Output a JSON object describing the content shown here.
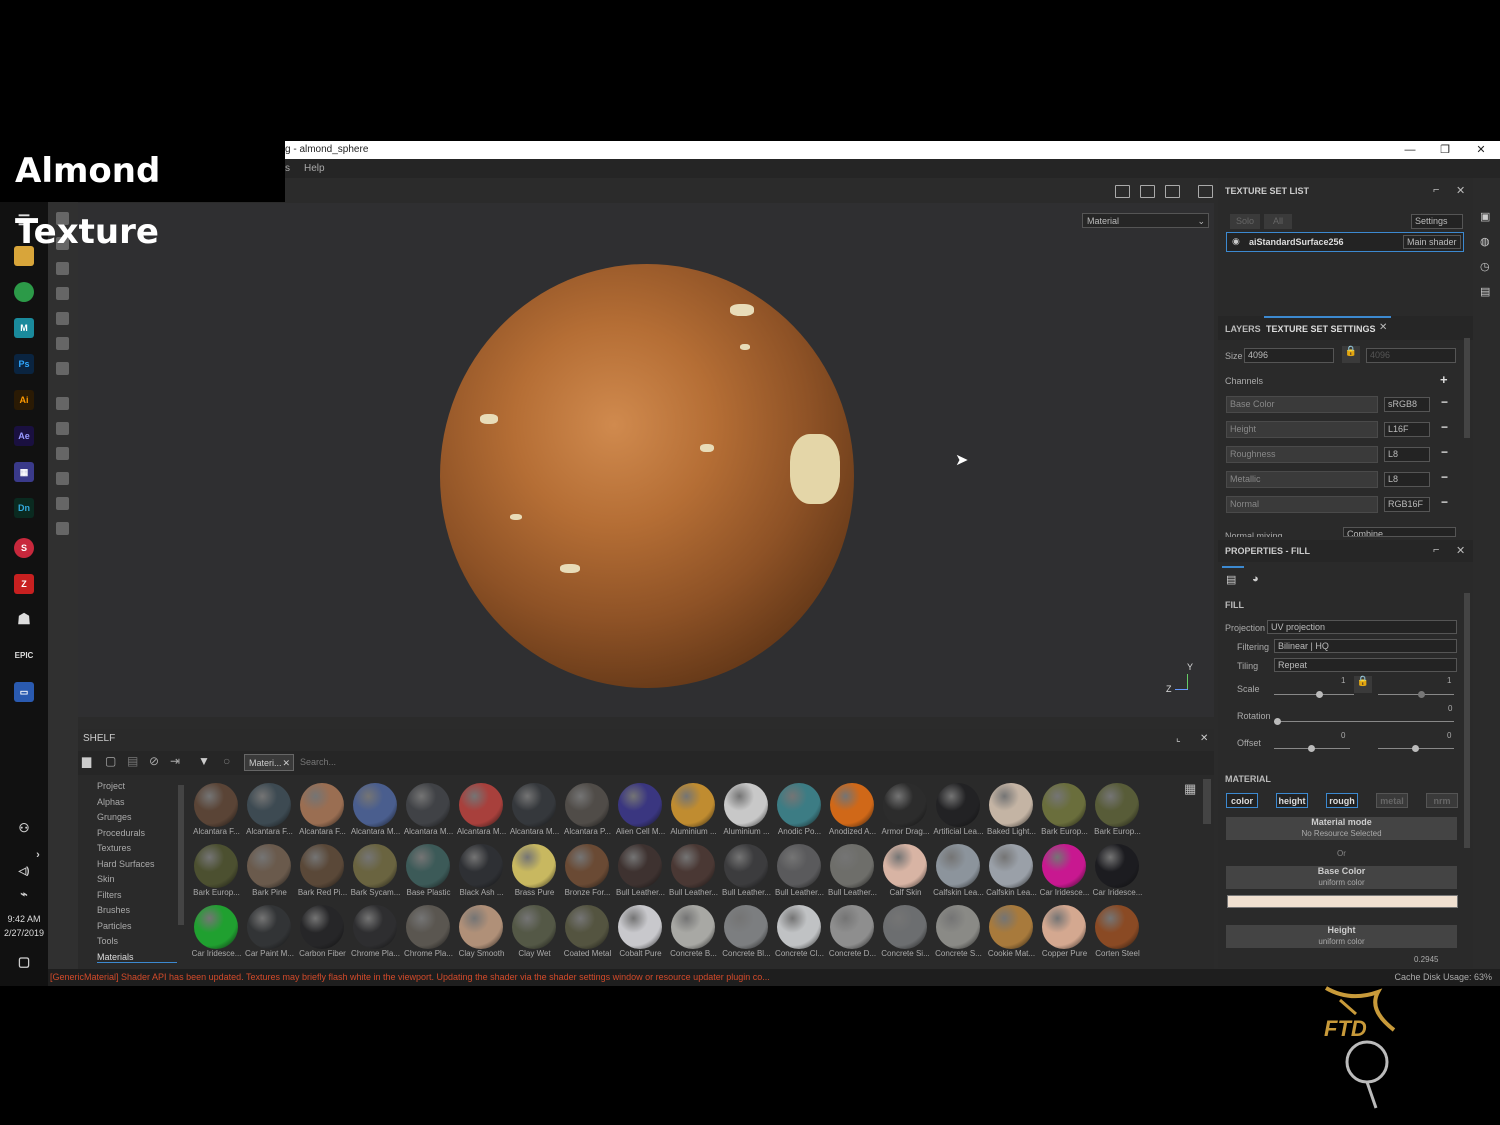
{
  "overlay_title": "Almond Texture",
  "window": {
    "title": "g - almond_sphere",
    "menu": [
      {
        "label": "s"
      },
      {
        "label": "Help"
      }
    ],
    "controls": [
      "—",
      "❐",
      "✕"
    ]
  },
  "viewport": {
    "mode_select": "Material",
    "axis_y": "Y",
    "axis_z": "Z"
  },
  "taskbar": {
    "time": "9:42 AM",
    "date": "2/27/2019"
  },
  "shelf": {
    "title": "SHELF",
    "filter_tab": "Materi...",
    "search_placeholder": "Search...",
    "categories": [
      {
        "label": "Project"
      },
      {
        "label": "Alphas"
      },
      {
        "label": "Grunges"
      },
      {
        "label": "Procedurals"
      },
      {
        "label": "Textures"
      },
      {
        "label": "Hard Surfaces"
      },
      {
        "label": "Skin"
      },
      {
        "label": "Filters"
      },
      {
        "label": "Brushes"
      },
      {
        "label": "Particles"
      },
      {
        "label": "Tools"
      },
      {
        "label": "Materials"
      }
    ],
    "materials": [
      {
        "label": "Alcantara F...",
        "color": "#5a4436"
      },
      {
        "label": "Alcantara F...",
        "color": "#3d4a52"
      },
      {
        "label": "Alcantara F...",
        "color": "#9a6e52"
      },
      {
        "label": "Alcantara M...",
        "color": "#4a5e8e"
      },
      {
        "label": "Alcantara M...",
        "color": "#404246"
      },
      {
        "label": "Alcantara M...",
        "color": "#a8403c"
      },
      {
        "label": "Alcantara M...",
        "color": "#35383c"
      },
      {
        "label": "Alcantara P...",
        "color": "#504c48"
      },
      {
        "label": "Alien Cell M...",
        "color": "#3a3680"
      },
      {
        "label": "Aluminium ...",
        "color": "#c08c30"
      },
      {
        "label": "Aluminium ...",
        "color": "#c8c8c8"
      },
      {
        "label": "Anodic Po...",
        "color": "#3c7c84"
      },
      {
        "label": "Anodized A...",
        "color": "#d06818"
      },
      {
        "label": "Armor Drag...",
        "color": "#2c2c2c"
      },
      {
        "label": "Artificial Lea...",
        "color": "#222224"
      },
      {
        "label": "Baked Light...",
        "color": "#c4b4a4"
      },
      {
        "label": "Bark Europ...",
        "color": "#6a6e3c"
      },
      {
        "label": "Bark Europ...",
        "color": "#585c38"
      },
      {
        "label": "Bark Europ...",
        "color": "#4c5030"
      },
      {
        "label": "Bark Pine",
        "color": "#6a5a4c"
      },
      {
        "label": "Bark Red Pi...",
        "color": "#5a4838"
      },
      {
        "label": "Bark Sycam...",
        "color": "#6a6440"
      },
      {
        "label": "Base Plastic",
        "color": "#3c5a58"
      },
      {
        "label": "Black Ash ...",
        "color": "#2e3034"
      },
      {
        "label": "Brass Pure",
        "color": "#c8b860"
      },
      {
        "label": "Bronze For...",
        "color": "#6a4a34"
      },
      {
        "label": "Bull Leather...",
        "color": "#3e3230"
      },
      {
        "label": "Bull Leather...",
        "color": "#4a3834"
      },
      {
        "label": "Bull Leather...",
        "color": "#3c3c3e"
      },
      {
        "label": "Bull Leather...",
        "color": "#5a5a5c"
      },
      {
        "label": "Bull Leather...",
        "color": "#6e6e6a"
      },
      {
        "label": "Calf Skin",
        "color": "#d8b4a4"
      },
      {
        "label": "Calfskin Lea...",
        "color": "#8c949c"
      },
      {
        "label": "Calfskin Lea...",
        "color": "#9aa0a8"
      },
      {
        "label": "Car Iridesce...",
        "color": "#c81890"
      },
      {
        "label": "Car Iridesce...",
        "color": "#1c1c20"
      },
      {
        "label": "Car Iridesce...",
        "color": "#20a030"
      },
      {
        "label": "Car Paint M...",
        "color": "#323436"
      },
      {
        "label": "Carbon Fiber",
        "color": "#262628"
      },
      {
        "label": "Chrome Pla...",
        "color": "#2e2e30"
      },
      {
        "label": "Chrome Pla...",
        "color": "#5a5650"
      },
      {
        "label": "Clay Smooth",
        "color": "#b09078"
      },
      {
        "label": "Clay Wet",
        "color": "#545846"
      },
      {
        "label": "Coated Metal",
        "color": "#545440"
      },
      {
        "label": "Cobalt Pure",
        "color": "#c8c8cc"
      },
      {
        "label": "Concrete B...",
        "color": "#a8a8a4"
      },
      {
        "label": "Concrete Bl...",
        "color": "#7c7e80"
      },
      {
        "label": "Concrete Cl...",
        "color": "#c0c2c4"
      },
      {
        "label": "Concrete D...",
        "color": "#8e8e8e"
      },
      {
        "label": "Concrete Si...",
        "color": "#6c6e70"
      },
      {
        "label": "Concrete S...",
        "color": "#8a8a86"
      },
      {
        "label": "Cookie Mat...",
        "color": "#a87a3c"
      },
      {
        "label": "Copper Pure",
        "color": "#d4a890"
      },
      {
        "label": "Corten Steel",
        "color": "#8a4a24"
      }
    ]
  },
  "status": {
    "message": "[GenericMaterial] Shader API has been updated. Textures may briefly flash white in the viewport. Updating the shader via the shader settings window or resource updater plugin co...",
    "cache": "Cache Disk Usage:   63%"
  },
  "texture_set_list": {
    "title": "TEXTURE SET LIST",
    "solo": "Solo",
    "all": "All",
    "settings": "Settings",
    "set_name": "aiStandardSurface256",
    "shader": "Main shader"
  },
  "texture_set_settings": {
    "tab_layers": "LAYERS",
    "tab_settings": "TEXTURE SET SETTINGS",
    "size_label": "Size",
    "size_value": "4096",
    "size_linked": "4096",
    "channels_label": "Channels",
    "channels": [
      {
        "name": "Base Color",
        "format": "sRGB8"
      },
      {
        "name": "Height",
        "format": "L16F"
      },
      {
        "name": "Roughness",
        "format": "L8"
      },
      {
        "name": "Metallic",
        "format": "L8"
      },
      {
        "name": "Normal",
        "format": "RGB16F"
      }
    ],
    "normal_mixing_label": "Normal mixing",
    "normal_mixing_value": "Combine"
  },
  "properties": {
    "title": "PROPERTIES - FILL",
    "fill_label": "FILL",
    "projection_label": "Projection",
    "projection_value": "UV projection",
    "filtering_label": "Filtering",
    "filtering_value": "Bilinear | HQ",
    "tiling_label": "Tiling",
    "tiling_value": "Repeat",
    "scale_label": "Scale",
    "scale_u": "1",
    "scale_v": "1",
    "rotation_label": "Rotation",
    "rotation_value": "0",
    "offset_label": "Offset",
    "offset_u": "0",
    "offset_v": "0",
    "material_label": "MATERIAL",
    "channel_buttons": [
      {
        "label": "color"
      },
      {
        "label": "height"
      },
      {
        "label": "rough"
      },
      {
        "label": "metal"
      },
      {
        "label": "nrm"
      }
    ],
    "material_mode_title": "Material mode",
    "material_mode_sub": "No Resource Selected",
    "or_label": "Or",
    "base_color_title": "Base Color",
    "base_color_sub": "uniform color",
    "base_color_swatch": "#f0e0d0",
    "height_title": "Height",
    "height_sub": "uniform color",
    "height_value": "0.2945"
  },
  "brand": {
    "logo_text": "FTD"
  }
}
